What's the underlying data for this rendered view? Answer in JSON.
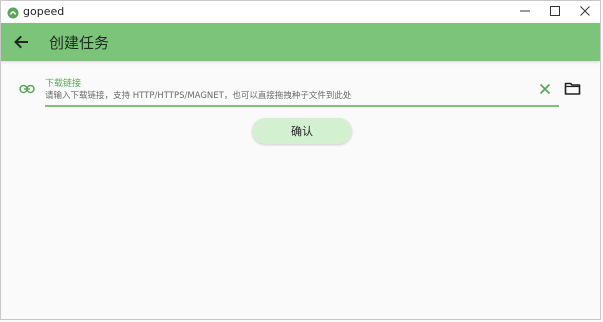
{
  "window": {
    "app_title": "gopeed"
  },
  "appbar": {
    "title": "创建任务"
  },
  "form": {
    "url_label": "下载链接",
    "url_placeholder": "请输入下载链接，支持 HTTP/HTTPS/MAGNET，也可以直接拖拽种子文件到此处",
    "url_value": ""
  },
  "actions": {
    "confirm_label": "确认"
  },
  "colors": {
    "accent": "#7cc47a",
    "accent_text": "#5aa758",
    "button_bg": "#d3f1d0"
  },
  "icons": {
    "app": "gopeed-logo-icon",
    "back": "arrow-left-icon",
    "link": "link-icon",
    "clear": "close-icon",
    "folder": "folder-icon",
    "minimize": "minimize-icon",
    "maximize": "maximize-icon",
    "close_window": "close-window-icon"
  }
}
